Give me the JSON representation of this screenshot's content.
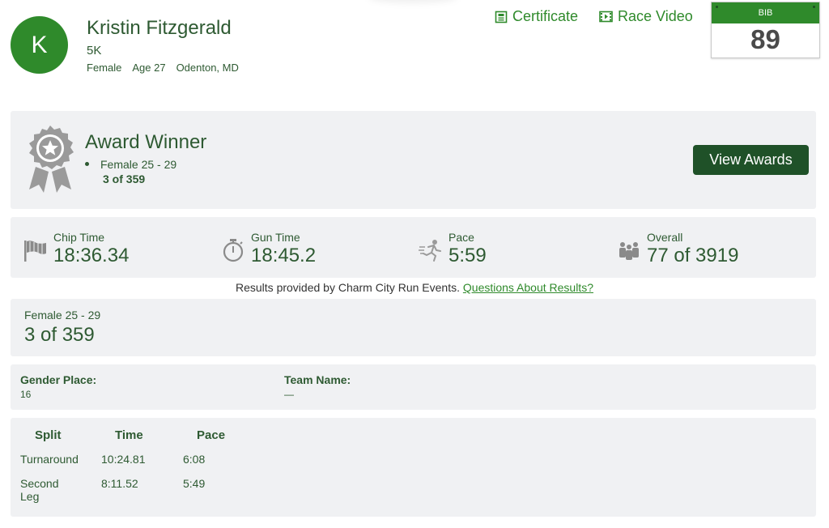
{
  "profile": {
    "avatar_letter": "K",
    "name": "Kristin Fitzgerald",
    "event": "5K",
    "gender": "Female",
    "age": "Age 27",
    "location": "Odenton, MD"
  },
  "links": {
    "certificate": "Certificate",
    "race_video": "Race Video"
  },
  "bib": {
    "label": "BIB",
    "number": "89"
  },
  "award": {
    "title": "Award Winner",
    "category": "Female 25 - 29",
    "place": "3 of 359",
    "button": "View Awards"
  },
  "stats": {
    "chip": {
      "label": "Chip Time",
      "value": "18:36.34",
      "icon": "flag-icon"
    },
    "gun": {
      "label": "Gun Time",
      "value": "18:45.2",
      "icon": "stopwatch-icon"
    },
    "pace": {
      "label": "Pace",
      "value": "5:59",
      "icon": "runner-icon"
    },
    "overall": {
      "label": "Overall",
      "value": "77 of 3919",
      "icon": "people-icon"
    }
  },
  "provided": {
    "text": "Results provided by Charm City Run Events.",
    "link": "Questions About Results?"
  },
  "division": {
    "name": "Female 25 - 29",
    "place": "3 of 359"
  },
  "info": {
    "gender_place_label": "Gender Place:",
    "gender_place_value": "16",
    "team_name_label": "Team Name:",
    "team_name_value": "—"
  },
  "splits": {
    "headers": [
      "Split",
      "Time",
      "Pace"
    ],
    "rows": [
      {
        "split": "Turnaround",
        "time": "10:24.81",
        "pace": "6:08"
      },
      {
        "split": "Second Leg",
        "time": "8:11.52",
        "pace": "5:49"
      }
    ]
  },
  "colors": {
    "brand_green": "#2f8a2b",
    "dark_green": "#1f5128",
    "text_green": "#2e5a32",
    "panel_gray": "#f0f1f3"
  }
}
